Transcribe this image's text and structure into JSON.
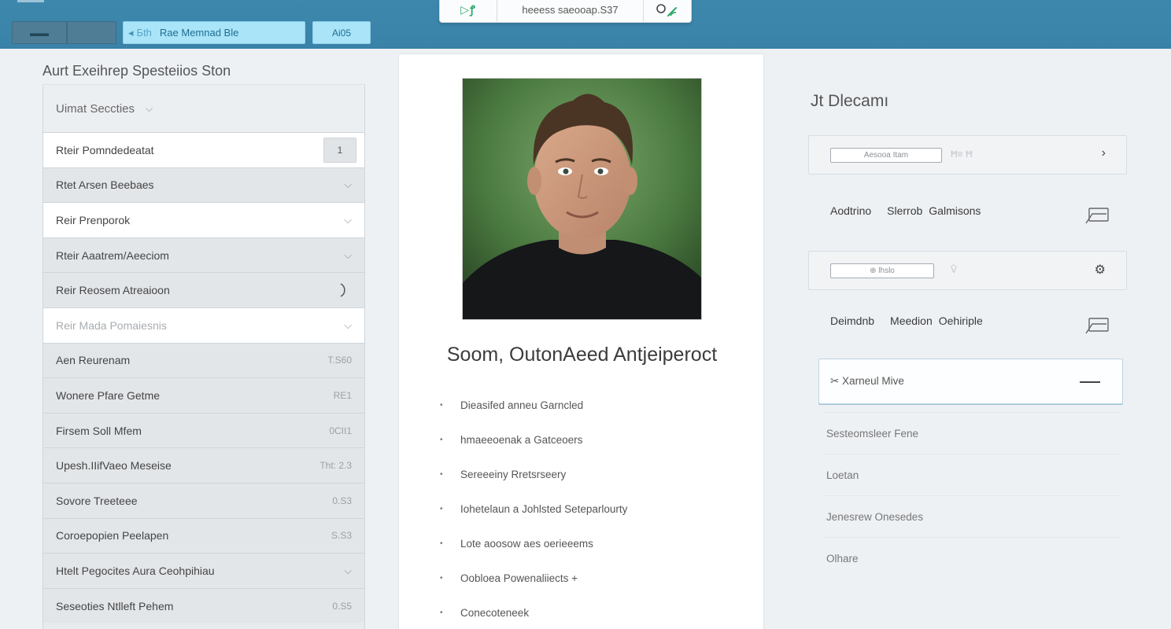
{
  "topbar": {
    "path_prefix": "Бth",
    "path_label": "Rae Memnad Ble",
    "action_label": "Ai05",
    "center_text": "heeess saeooap.S37",
    "play_symbol": "▷ꝭ",
    "colors": {
      "bar": "#3a82a8",
      "path_bg": "#a9e4f8",
      "accent_green": "#2aa86a"
    }
  },
  "left": {
    "title": "Aurt Exeihrep Spesteiios Ston",
    "header": "Uimat Seccties",
    "rows": [
      {
        "label": "Rteir Pomndedeatat",
        "badge": "1",
        "style": "white"
      },
      {
        "label": "Rtet Arsen Beebaes",
        "chevron": true,
        "style": "gray"
      },
      {
        "label": "Reir Prenporok",
        "chevron": true,
        "style": "white"
      },
      {
        "label": "Rteir Aaatrem/Aeeciom",
        "chevron": true,
        "style": "gray"
      },
      {
        "label": "Reir Reosem Atreaioon",
        "spinner": true,
        "style": "gray"
      },
      {
        "label": "Reir Mada Pomaiesnis",
        "chevron": true,
        "style": "white",
        "muted": true
      },
      {
        "label": "Aen Reurenam",
        "value": "T.S60",
        "style": "gray"
      },
      {
        "label": "Wonere Pfare Getme",
        "value": "RE1",
        "style": "gray"
      },
      {
        "label": "Firsem Soll Mfem",
        "value": "0CII1",
        "style": "gray"
      },
      {
        "label": "Upesh.IIifVaeo Meseise",
        "value": "Tht: 2.3",
        "style": "gray"
      },
      {
        "label": "Sovore Treeteee",
        "value": "0.S3",
        "style": "gray"
      },
      {
        "label": "Coroepopien Peelapen",
        "value": "S.S3",
        "style": "gray"
      },
      {
        "label": "Htelt Pegocites  Aura Ceohpihiau",
        "chevron": true,
        "style": "gray"
      },
      {
        "label": "Seseoties Ntlleft Pehem",
        "value": "0.S5",
        "style": "gray"
      }
    ]
  },
  "card": {
    "title": "Soom, OutonAeed Antjeiperoct",
    "bullets": [
      "Dieasifed anneu Garncled",
      "hmaeeoenak a Gatceoers",
      "Sereeeiny Rretsrseery",
      "Iohetelaun a Johlsted Seteparlourty",
      "Lote aoosow aes oerieeems",
      "Oobloea Powenaliiects  +",
      "Conecoteneek"
    ]
  },
  "right": {
    "title": "Jt Dlecamı",
    "box1": {
      "field": "Aesooa Itam",
      "faint": "Ħ≡    Ħ"
    },
    "line1": [
      "Aodtrino",
      "Slerrob",
      "Galmisons"
    ],
    "box2": {
      "field": "⊕  lhslo",
      "faint": "Ṽ"
    },
    "line2": [
      "Deimdnb",
      "Meedion",
      "Oehiriple"
    ],
    "selected": "✂ Xarneul Mive",
    "list": [
      "Sesteomsleer Fene",
      "Loetan",
      "Jenesrew Onesedes",
      "Olhare"
    ]
  }
}
